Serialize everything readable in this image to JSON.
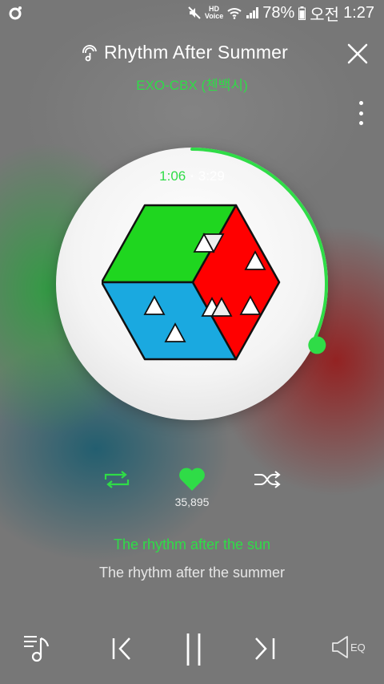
{
  "status_bar": {
    "hd_voice_label": "HD\nVoice",
    "battery": "78%",
    "am_pm": "오전",
    "time": "1:27"
  },
  "player": {
    "title": "Rhythm After Summer",
    "artist": "EXO-CBX (첸백시)",
    "time_current": "1:06",
    "time_separator": "•",
    "time_total": "3:29",
    "progress_fraction": 0.316,
    "like_count": "35,895",
    "liked": true
  },
  "lyrics": {
    "current": "The rhythm after the sun",
    "next": "The rhythm after the summer"
  },
  "bottom_bar": {
    "eq_label": "EQ"
  },
  "colors": {
    "accent": "#2fdc47",
    "album_green": "#1fd61f",
    "album_red": "#ff0000",
    "album_blue": "#1aa9e0"
  },
  "icons": {
    "app": "app-logo-icon",
    "mute": "mute-icon",
    "wifi": "wifi-icon",
    "signal": "signal-icon",
    "battery": "battery-icon",
    "lyrics_mode": "lyrics-icon",
    "close": "close-icon",
    "more": "more-icon",
    "repeat": "repeat-icon",
    "like": "heart-icon",
    "shuffle": "shuffle-icon",
    "playlist": "playlist-icon",
    "previous": "previous-icon",
    "pause": "pause-icon",
    "next": "next-icon",
    "equalizer": "equalizer-icon"
  }
}
